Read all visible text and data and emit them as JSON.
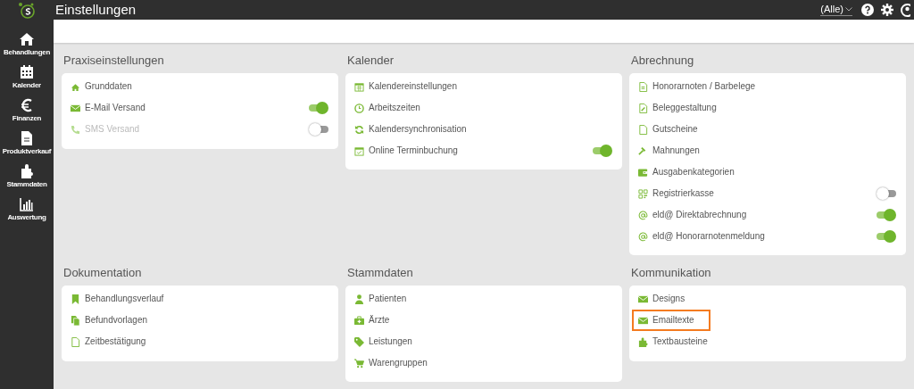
{
  "app_bar": {
    "title": "Einstellungen",
    "filter": "(Alle)"
  },
  "nav": [
    {
      "label": "Behandlungen"
    },
    {
      "label": "Kalender"
    },
    {
      "label": "Finanzen"
    },
    {
      "label": "Produktverkauf"
    },
    {
      "label": "Stammdaten"
    },
    {
      "label": "Auswertung"
    }
  ],
  "sections": [
    {
      "title": "Praxiseinstellungen",
      "items": [
        {
          "label": "Grunddaten",
          "kind": "link",
          "disabled": false,
          "highlighted": false
        },
        {
          "label": "E-Mail Versand",
          "kind": "toggle",
          "on": true,
          "disabled": false,
          "highlighted": false
        },
        {
          "label": "SMS Versand",
          "kind": "toggle",
          "on": false,
          "disabled": true,
          "highlighted": false
        }
      ]
    },
    {
      "title": "Kalender",
      "items": [
        {
          "label": "Kalendereinstellungen",
          "kind": "link",
          "disabled": false,
          "highlighted": false
        },
        {
          "label": "Arbeitszeiten",
          "kind": "link",
          "disabled": false,
          "highlighted": false
        },
        {
          "label": "Kalendersynchronisation",
          "kind": "link",
          "disabled": false,
          "highlighted": false
        },
        {
          "label": "Online Terminbuchung",
          "kind": "toggle",
          "on": true,
          "disabled": false,
          "highlighted": false
        }
      ]
    },
    {
      "title": "Abrechnung",
      "items": [
        {
          "label": "Honorarnoten / Barbelege",
          "kind": "link",
          "disabled": false,
          "highlighted": false
        },
        {
          "label": "Beleggestaltung",
          "kind": "link",
          "disabled": false,
          "highlighted": false
        },
        {
          "label": "Gutscheine",
          "kind": "link",
          "disabled": false,
          "highlighted": false
        },
        {
          "label": "Mahnungen",
          "kind": "link",
          "disabled": false,
          "highlighted": false
        },
        {
          "label": "Ausgabenkategorien",
          "kind": "link",
          "disabled": false,
          "highlighted": false
        },
        {
          "label": "Registrierkasse",
          "kind": "toggle",
          "on": false,
          "disabled": false,
          "highlighted": false
        },
        {
          "label": "eld@ Direktabrechnung",
          "kind": "toggle",
          "on": true,
          "disabled": false,
          "highlighted": false
        },
        {
          "label": "eld@ Honorarnotenmeldung",
          "kind": "toggle",
          "on": true,
          "disabled": false,
          "highlighted": false
        }
      ]
    },
    {
      "title": "Dokumentation",
      "items": [
        {
          "label": "Behandlungsverlauf",
          "kind": "link",
          "disabled": false,
          "highlighted": false
        },
        {
          "label": "Befundvorlagen",
          "kind": "link",
          "disabled": false,
          "highlighted": false
        },
        {
          "label": "Zeitbestätigung",
          "kind": "link",
          "disabled": false,
          "highlighted": false
        }
      ]
    },
    {
      "title": "Stammdaten",
      "items": [
        {
          "label": "Patienten",
          "kind": "link",
          "disabled": false,
          "highlighted": false
        },
        {
          "label": "Ärzte",
          "kind": "link",
          "disabled": false,
          "highlighted": false
        },
        {
          "label": "Leistungen",
          "kind": "link",
          "disabled": false,
          "highlighted": false
        },
        {
          "label": "Warengruppen",
          "kind": "link",
          "disabled": false,
          "highlighted": false
        }
      ]
    },
    {
      "title": "Kommunikation",
      "items": [
        {
          "label": "Designs",
          "kind": "link",
          "disabled": false,
          "highlighted": false
        },
        {
          "label": "Emailtexte",
          "kind": "link",
          "disabled": false,
          "highlighted": true
        },
        {
          "label": "Textbausteine",
          "kind": "link",
          "disabled": false,
          "highlighted": false
        }
      ]
    }
  ]
}
